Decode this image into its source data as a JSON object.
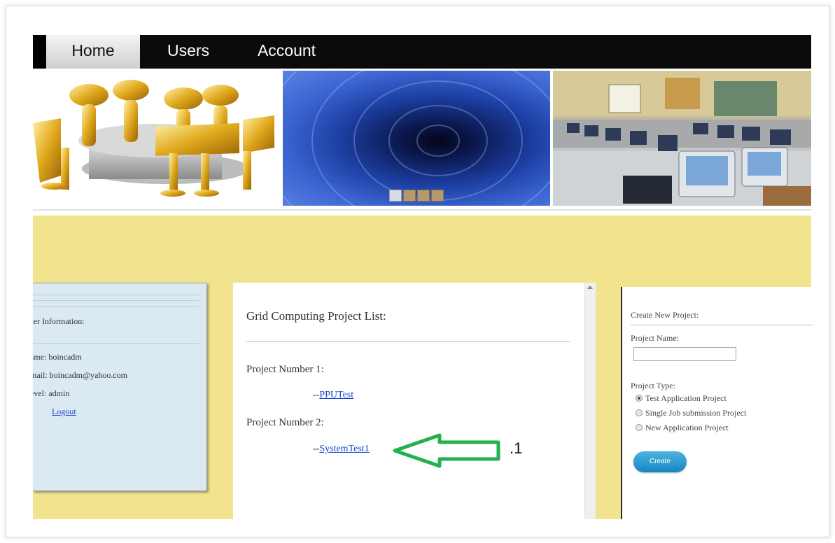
{
  "nav": {
    "tabs": [
      {
        "label": "Home",
        "active": true
      },
      {
        "label": "Users",
        "active": false
      },
      {
        "label": "Account",
        "active": false
      }
    ]
  },
  "banner": {
    "images": [
      "golden figures around table",
      "blue binary tunnel",
      "computer lab"
    ],
    "slider_dots": 4
  },
  "user_info": {
    "title": "ser Information:",
    "name": "ame: boincadm",
    "email": "mail: boincadm@yahoo.com",
    "level": "evel: admin",
    "logout": "Logout"
  },
  "project_list": {
    "heading": "Grid Computing Project List:",
    "projects": [
      {
        "number_label": "Project Number 1:",
        "prefix": "--",
        "link": "PPUTest"
      },
      {
        "number_label": "Project Number 2:",
        "prefix": "--",
        "link": "SystemTest1"
      }
    ]
  },
  "create_project": {
    "title": "Create New Project:",
    "name_label": "Project Name:",
    "name_value": "",
    "type_label": "Project Type:",
    "types": [
      {
        "label": "Test Application Project",
        "selected": true
      },
      {
        "label": "Single Job submission Project",
        "selected": false
      },
      {
        "label": "New Application Project",
        "selected": false
      }
    ],
    "button": "Create"
  },
  "annotation": {
    "label": ".1",
    "arrow_color": "#22b14c"
  },
  "colors": {
    "nav_bg": "#0b0b0b",
    "content_bg": "#f2e38e",
    "user_box_bg": "#dbe9f3",
    "link": "#1a44c7",
    "button": "#1686c0"
  }
}
